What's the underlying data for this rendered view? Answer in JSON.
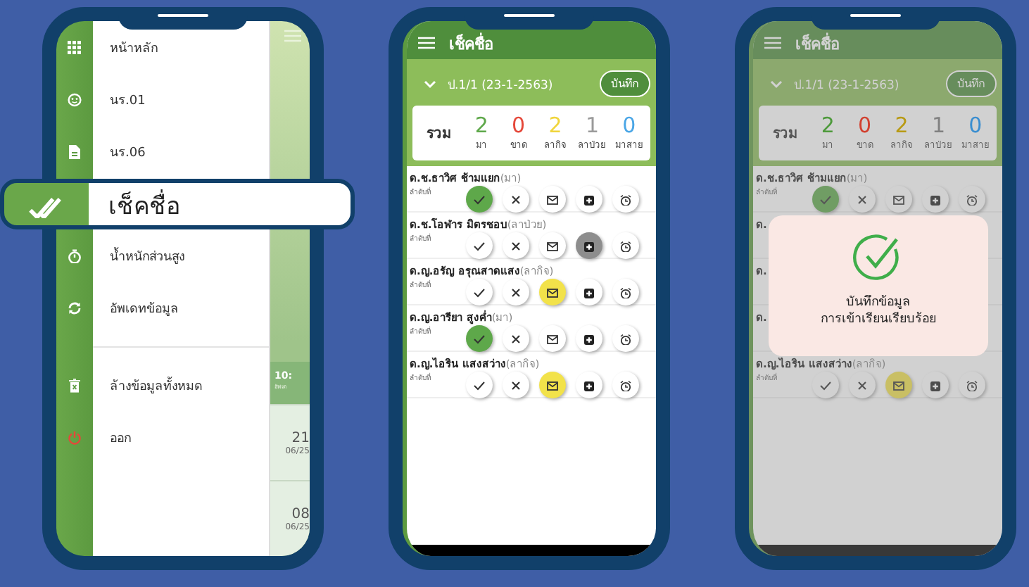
{
  "phones": [
    {
      "kind": "menu",
      "menu": [
        {
          "label": "หน้าหลัก",
          "selected": false,
          "divider_before": false
        },
        {
          "label": "นร.01",
          "selected": false,
          "divider_before": false
        },
        {
          "label": "นร.06",
          "selected": false,
          "divider_before": false
        },
        {
          "label": "เช็คชื่อ",
          "selected": true,
          "divider_before": false
        },
        {
          "label": "น้ำหนักส่วนสูง",
          "selected": false,
          "divider_before": false
        },
        {
          "label": "อัพเดทข้อมูล",
          "selected": false,
          "divider_before": false
        },
        {
          "label": "ล้างข้อมูลทั้งหมด",
          "selected": false,
          "divider_before": true
        },
        {
          "label": "ออก",
          "selected": false,
          "divider_before": false
        }
      ],
      "behind": {
        "header": "10:",
        "header_note": "อัพเด",
        "entries": [
          {
            "day": "21",
            "date": "06/25"
          },
          {
            "day": "08",
            "date": "06/25"
          }
        ]
      }
    },
    {
      "kind": "attendance",
      "title": "เช็คชื่อ",
      "class_label": "ป.1/1 (23-1-2563)",
      "save": "บันทึก",
      "total_label": "รวม",
      "counts": [
        {
          "value": "2",
          "label": "มา",
          "color": "#5ea84a"
        },
        {
          "value": "0",
          "label": "ขาด",
          "color": "#e5483a"
        },
        {
          "value": "2",
          "label": "ลากิจ",
          "color": "#f0d53c"
        },
        {
          "value": "1",
          "label": "ลาป่วย",
          "color": "#9a9a9a"
        },
        {
          "value": "0",
          "label": "มาสาย",
          "color": "#4aa6e6"
        }
      ],
      "rows": [
        {
          "name": "ด.ช.ธาวิศ ช้ามแยก",
          "status_label": "(มา)",
          "note": "ลำดับที่",
          "buttons": [
            {
              "selected": true
            },
            {
              "selected": false
            },
            {
              "selected": false
            },
            {
              "selected": false
            },
            {
              "selected": false
            }
          ]
        },
        {
          "name": "ด.ช.โอฬาร มิตรชอบ",
          "status_label": "(ลาป่วย)",
          "note": "ลำดับที่",
          "buttons": [
            {
              "selected": false
            },
            {
              "selected": false
            },
            {
              "selected": false
            },
            {
              "selected": true
            },
            {
              "selected": false
            }
          ]
        },
        {
          "name": "ด.ญ.อรัญ อรุณสาดแสง",
          "status_label": "(ลากิจ)",
          "note": "ลำดับที่",
          "buttons": [
            {
              "selected": false
            },
            {
              "selected": false
            },
            {
              "selected": true
            },
            {
              "selected": false
            },
            {
              "selected": false
            }
          ]
        },
        {
          "name": "ด.ญ.อารียา สูงค่ำ",
          "status_label": "(มา)",
          "note": "ลำดับที่",
          "buttons": [
            {
              "selected": true
            },
            {
              "selected": false
            },
            {
              "selected": false
            },
            {
              "selected": false
            },
            {
              "selected": false
            }
          ]
        },
        {
          "name": "ด.ญ.ไอริน แสงสว่าง",
          "status_label": "(ลากิจ)",
          "note": "ลำดับที่",
          "buttons": [
            {
              "selected": false
            },
            {
              "selected": false
            },
            {
              "selected": true
            },
            {
              "selected": false
            },
            {
              "selected": false
            }
          ]
        }
      ],
      "dimmed": false
    },
    {
      "kind": "attendance",
      "title": "เช็คชื่อ",
      "class_label": "ป.1/1 (23-1-2563)",
      "save": "บันทึก",
      "total_label": "รวม",
      "counts": [
        {
          "value": "2",
          "label": "มา",
          "color": "#4e9a3c"
        },
        {
          "value": "0",
          "label": "ขาด",
          "color": "#d2402f"
        },
        {
          "value": "2",
          "label": "ลากิจ",
          "color": "#b89a14"
        },
        {
          "value": "1",
          "label": "ลาป่วย",
          "color": "#808080"
        },
        {
          "value": "0",
          "label": "มาสาย",
          "color": "#3a8ed0"
        }
      ],
      "rows": [
        {
          "name": "ด.ช.ธาวิศ ช้ามแยก",
          "status_label": "(มา)",
          "note": "ลำดับที่",
          "buttons": [
            {
              "selected": true
            },
            {
              "selected": false
            },
            {
              "selected": false
            },
            {
              "selected": false
            },
            {
              "selected": false
            }
          ]
        },
        {
          "name": "ด."
        },
        {
          "name": "ด."
        },
        {
          "name": "ด."
        },
        {
          "name": "ด.ญ.ไอริน แสงสว่าง",
          "status_label": "(ลากิจ)",
          "note": "ลำดับที่",
          "buttons": [
            {
              "selected": false
            },
            {
              "selected": false
            },
            {
              "selected": true
            },
            {
              "selected": false
            },
            {
              "selected": false
            }
          ]
        }
      ],
      "dimmed": true,
      "dialog": {
        "lines": [
          "บันทึกข้อมูล",
          "การเข้าเรียนเรียบร้อย"
        ]
      }
    }
  ]
}
